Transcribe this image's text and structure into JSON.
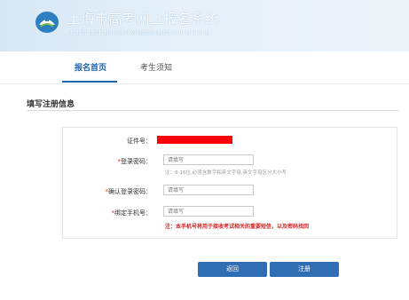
{
  "header": {
    "title": "上海市高考网上报名系统",
    "subtitle": "shanghaishigaokaowangshangbaomingxitong"
  },
  "nav": {
    "tabs": [
      {
        "label": "报名首页",
        "active": true
      },
      {
        "label": "考生须知",
        "active": false
      }
    ]
  },
  "section": {
    "title": "填写注册信息"
  },
  "form": {
    "id_label": "证件号：",
    "password_label": "登录密码：",
    "password_placeholder": "请填写",
    "password_hint": "注：8-16位,必须含数字和英文字母,英文字母区分大小写",
    "confirm_label": "确认登录密码：",
    "confirm_placeholder": "请填写",
    "phone_label": "绑定手机号：",
    "phone_placeholder": "请填写",
    "phone_warning": "注：本手机号将用于接收考试相关的重要短信，以及密码找回",
    "required_mark": "*"
  },
  "buttons": {
    "back": "返回",
    "register": "注册"
  },
  "colors": {
    "accent": "#1d63ad",
    "button": "#2f6db5",
    "warning": "#d42020",
    "redacted": "#ff0000"
  },
  "icons": {
    "logo": "logo-icon"
  }
}
